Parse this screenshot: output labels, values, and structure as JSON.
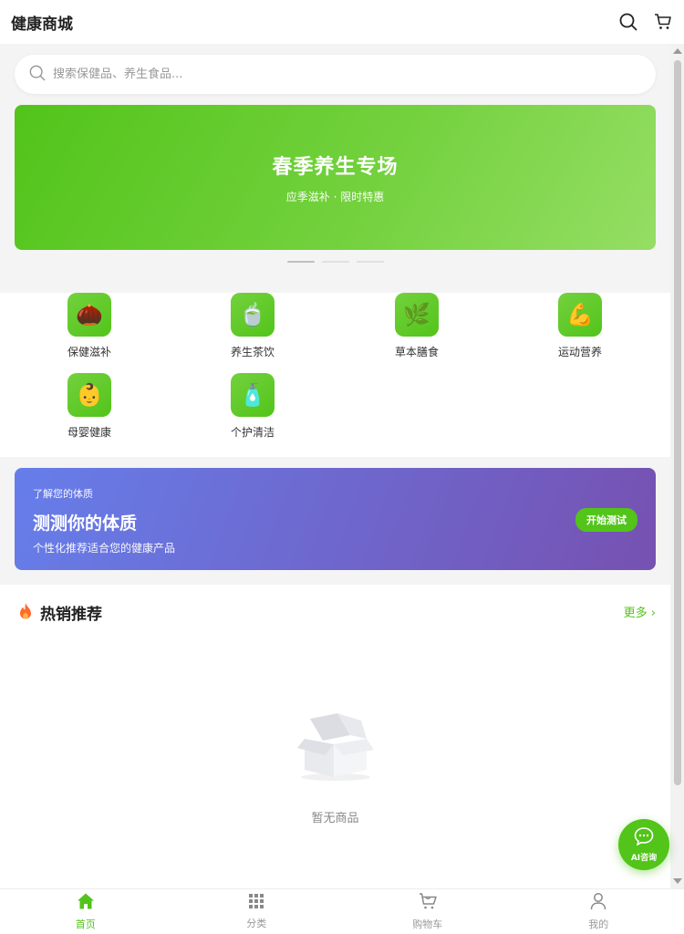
{
  "header": {
    "title": "健康商城",
    "search_icon": "search-icon",
    "cart_icon": "cart-icon"
  },
  "search": {
    "placeholder": "搜索保健品、养生食品..."
  },
  "banner": {
    "title": "春季养生专场",
    "subtitle": "应季滋补 · 限时特惠",
    "slide_count": 3,
    "active_slide": 1
  },
  "categories": [
    {
      "label": "保健滋补",
      "icon": "🌰"
    },
    {
      "label": "养生茶饮",
      "icon": "🍵"
    },
    {
      "label": "草本膳食",
      "icon": "🌿"
    },
    {
      "label": "运动营养",
      "icon": "💪"
    },
    {
      "label": "母婴健康",
      "icon": "👶"
    },
    {
      "label": "个护清洁",
      "icon": "🧴"
    }
  ],
  "quiz": {
    "eyebrow": "了解您的体质",
    "title": "测测你的体质",
    "desc": "个性化推荐适合您的健康产品",
    "button": "开始测试"
  },
  "hot": {
    "title": "热销推荐",
    "more": "更多 ›",
    "empty_text": "暂无商品"
  },
  "fab": {
    "label": "AI咨询"
  },
  "tabbar": [
    {
      "label": "首页",
      "icon": "home-icon",
      "active": true
    },
    {
      "label": "分类",
      "icon": "grid-icon",
      "active": false
    },
    {
      "label": "购物车",
      "icon": "cart-icon",
      "active": false
    },
    {
      "label": "我的",
      "icon": "user-icon",
      "active": false
    }
  ],
  "colors": {
    "accent": "#52c41a",
    "quiz_start": "#667eea",
    "quiz_end": "#7651b1"
  }
}
